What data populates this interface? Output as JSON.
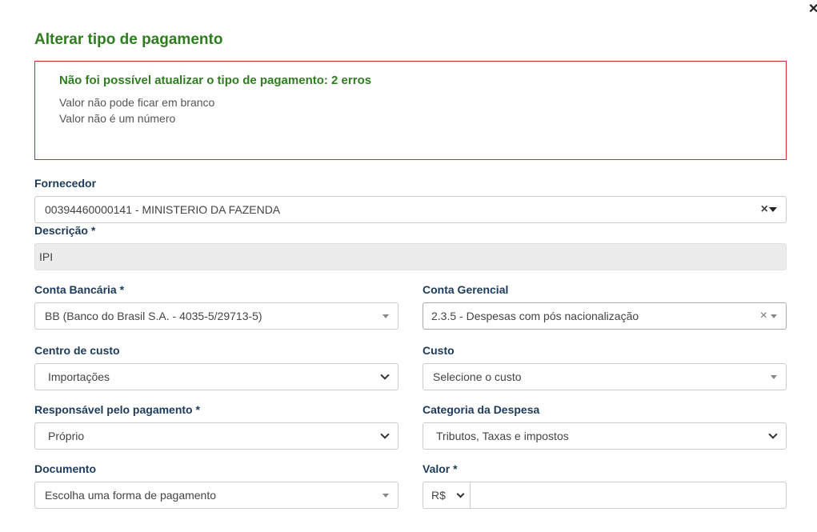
{
  "modal": {
    "title": "Alterar tipo de pagamento",
    "close_icon": "close-icon"
  },
  "alert": {
    "title": "Não foi possível atualizar o tipo de pagamento: 2 erros",
    "errors": [
      "Valor não pode ficar em branco",
      "Valor não é um número"
    ],
    "border_color": "#c9302c"
  },
  "form": {
    "fornecedor": {
      "label": "Fornecedor",
      "value": "00394460000141 - MINISTERIO DA FAZENDA"
    },
    "descricao": {
      "label": "Descrição *",
      "value": "IPI"
    },
    "conta_bancaria": {
      "label": "Conta Bancária *",
      "value": "BB (Banco do Brasil S.A. - 4035-5/29713-5)"
    },
    "conta_gerencial": {
      "label": "Conta Gerencial",
      "value": "2.3.5 - Despesas com pós nacionalização"
    },
    "centro_custo": {
      "label": "Centro de custo",
      "value": "Importações"
    },
    "custo": {
      "label": "Custo",
      "placeholder": "Selecione o custo"
    },
    "responsavel": {
      "label": "Responsável pelo pagamento *",
      "value": "Próprio"
    },
    "categoria": {
      "label": "Categoria da Despesa",
      "value": "Tributos, Taxas e impostos"
    },
    "documento": {
      "label": "Documento",
      "placeholder": "Escolha uma forma de pagamento"
    },
    "valor": {
      "label": "Valor *",
      "currency": "R$",
      "value": ""
    }
  },
  "colors": {
    "title_green": "#2e7d1f",
    "label_navy": "#1c3b5a"
  }
}
